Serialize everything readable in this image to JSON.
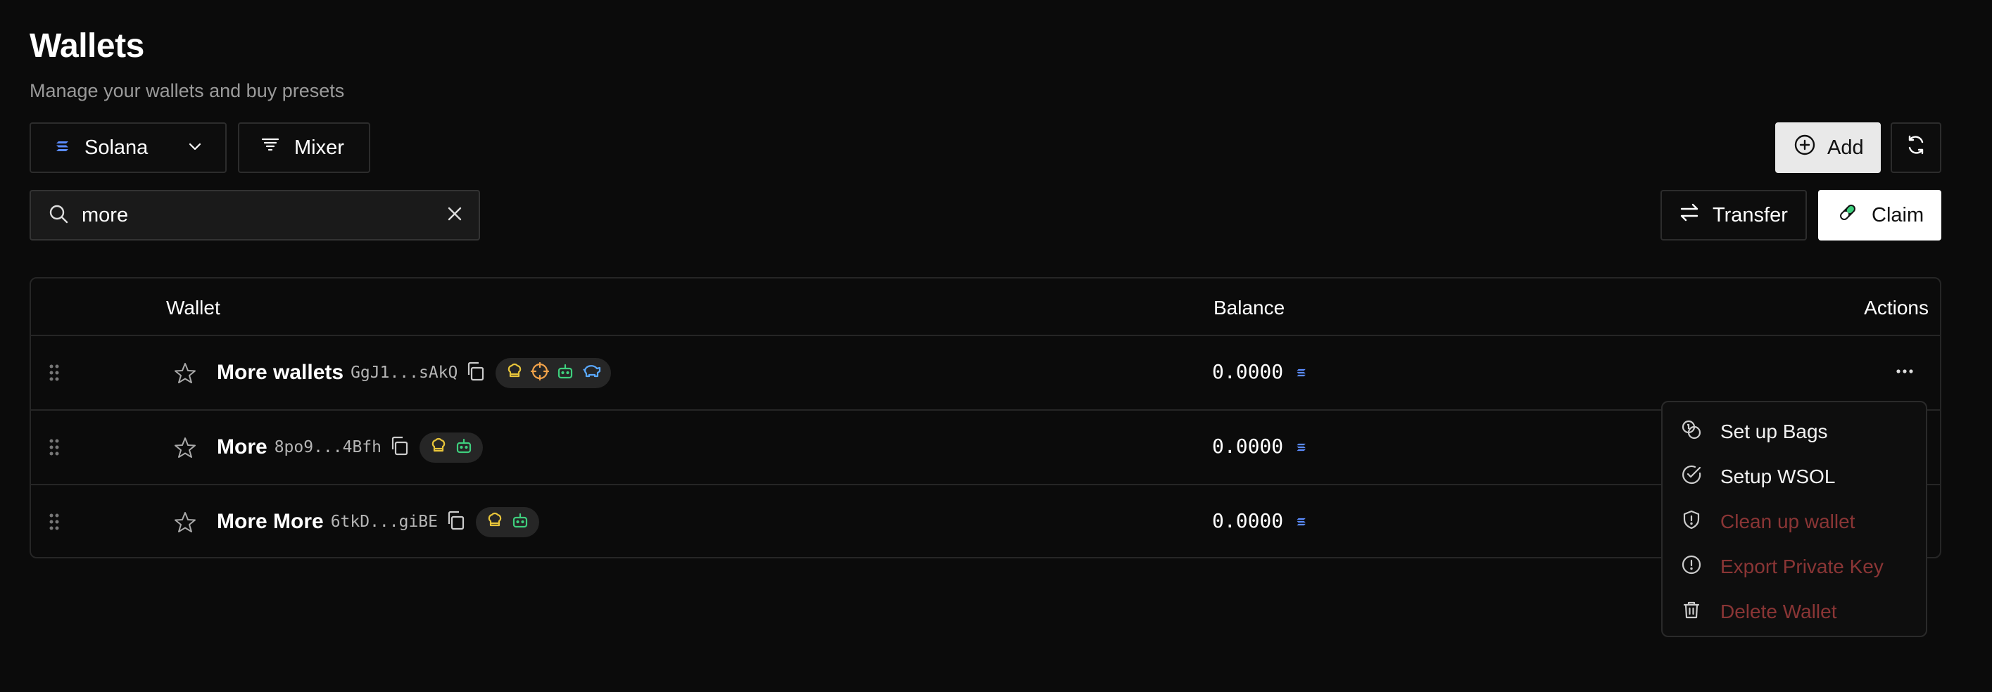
{
  "page": {
    "title": "Wallets",
    "subtitle": "Manage your wallets and buy presets"
  },
  "toolbar": {
    "chain_label": "Solana",
    "mixer_label": "Mixer",
    "add_label": "Add",
    "transfer_label": "Transfer",
    "claim_label": "Claim"
  },
  "search": {
    "value": "more",
    "placeholder": ""
  },
  "table": {
    "headers": {
      "wallet": "Wallet",
      "balance": "Balance",
      "actions": "Actions"
    },
    "rows": [
      {
        "name": "More wallets",
        "address": "GgJ1...sAkQ",
        "balance": "0.0000",
        "badges": [
          "chef-hat-icon",
          "crosshair-icon",
          "bot-icon",
          "piggy-bank-icon"
        ]
      },
      {
        "name": "More",
        "address": "8po9...4Bfh",
        "balance": "0.0000",
        "badges": [
          "chef-hat-icon",
          "bot-icon"
        ]
      },
      {
        "name": "More More",
        "address": "6tkD...giBE",
        "balance": "0.0000",
        "badges": [
          "chef-hat-icon",
          "bot-icon"
        ]
      }
    ]
  },
  "menu": {
    "items": [
      {
        "label": "Set up Bags",
        "icon": "coins-icon",
        "danger": false
      },
      {
        "label": "Setup WSOL",
        "icon": "check-circle-icon",
        "danger": false
      },
      {
        "label": "Clean up wallet",
        "icon": "shield-alert-icon",
        "danger": true
      },
      {
        "label": "Export Private Key",
        "icon": "alert-circle-icon",
        "danger": true
      },
      {
        "label": "Delete Wallet",
        "icon": "trash-icon",
        "danger": true
      }
    ]
  },
  "colors": {
    "background": "#0b0b0b",
    "danger": "#8a3535",
    "badge_yellow": "#e8c53a",
    "badge_orange": "#f0a24a",
    "badge_green": "#3ecf7d",
    "badge_blue": "#5aa9ff",
    "solana_blue": "#5b8cff"
  }
}
